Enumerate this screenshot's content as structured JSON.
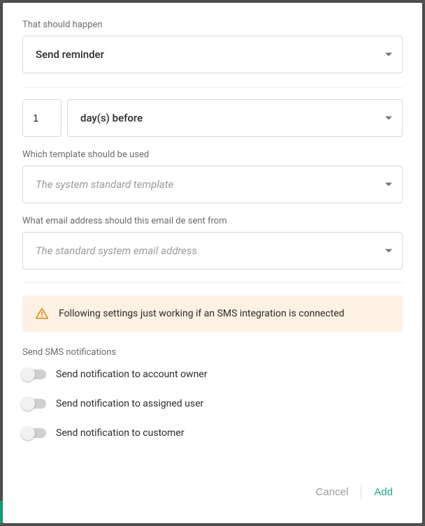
{
  "action": {
    "label": "That should happen",
    "value": "Send reminder"
  },
  "timing": {
    "count": "1",
    "unit": "day(s) before"
  },
  "template": {
    "label": "Which template should be used",
    "placeholder": "The system standard template"
  },
  "emailFrom": {
    "label": "What email address should this email de sent from",
    "placeholder": "The standard system email address"
  },
  "alert": {
    "text": "Following settings just working if an SMS integration is connected"
  },
  "sms": {
    "sectionLabel": "Send SMS notifications",
    "toggles": [
      {
        "label": "Send notification to account owner"
      },
      {
        "label": "Send notification to assigned user"
      },
      {
        "label": "Send notification to customer"
      }
    ]
  },
  "footer": {
    "cancel": "Cancel",
    "add": "Add"
  }
}
